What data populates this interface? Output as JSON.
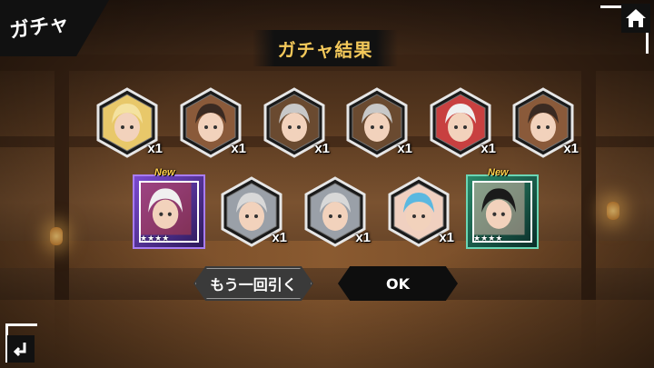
{
  "screen": {
    "corner_label": "ガチャ",
    "title": "ガチャ結果"
  },
  "buttons": {
    "retry_label": "もう一回引く",
    "ok_label": "OK"
  },
  "colors": {
    "title_text": "#f3c85a",
    "new_tag": "#ffcf4a",
    "hex_frame": "#d0d0d0"
  },
  "results_row1": [
    {
      "character": "blonde-girl",
      "quantity": "x1"
    },
    {
      "character": "dark-hair-girl",
      "quantity": "x1"
    },
    {
      "character": "armored-dwarf",
      "quantity": "x1"
    },
    {
      "character": "armored-dwarf",
      "quantity": "x1"
    },
    {
      "character": "white-hair-boy",
      "quantity": "x1"
    },
    {
      "character": "dark-hair-girl",
      "quantity": "x1"
    }
  ],
  "results_row2": [
    {
      "character": "white-hair-boy",
      "rarity": "4-star",
      "new": "New",
      "stars": "★★★★",
      "frame": "purple"
    },
    {
      "character": "silver-hair-man",
      "quantity": "x1"
    },
    {
      "character": "silver-hair-man",
      "quantity": "x1"
    },
    {
      "character": "blue-hair-girl",
      "quantity": "x1"
    },
    {
      "character": "black-hair-girl",
      "rarity": "4-star",
      "new": "New",
      "stars": "★★★★",
      "frame": "green"
    }
  ],
  "icons": {
    "home": "home-icon",
    "back": "back-icon"
  }
}
